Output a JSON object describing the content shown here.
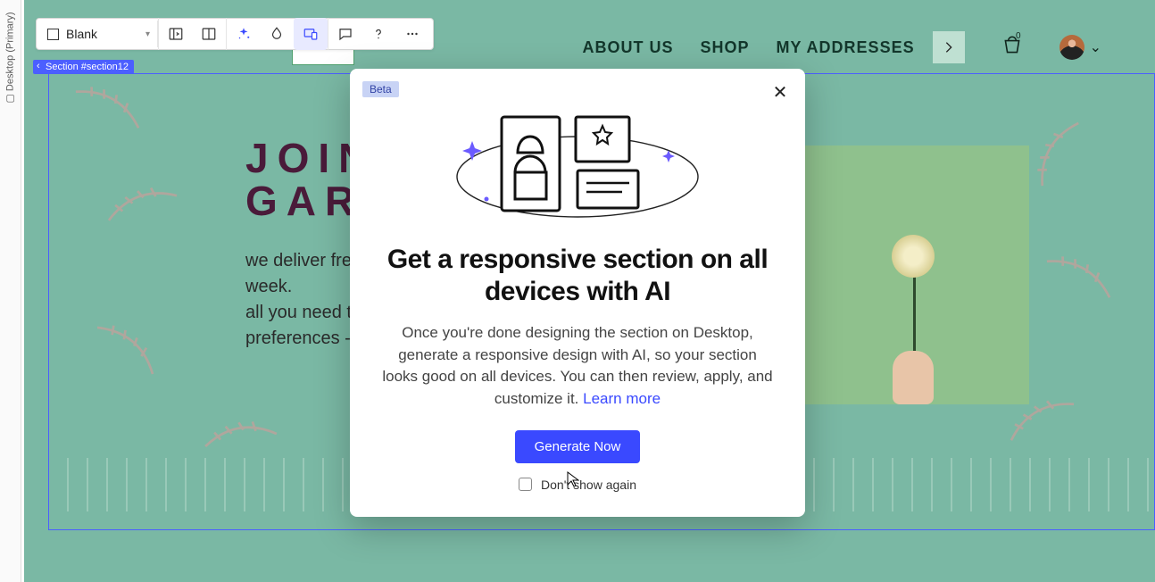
{
  "viewport_rail": {
    "label": "Desktop (Primary)"
  },
  "toolbar": {
    "dropdown_label": "Blank",
    "icons": [
      "panel-left",
      "panel-split",
      "ai-sparkle",
      "paint-drop",
      "responsive",
      "comment",
      "help",
      "more"
    ]
  },
  "site_nav": {
    "items": [
      "ABOUT US",
      "SHOP",
      "MY ADDRESSES"
    ],
    "cart_count": "0"
  },
  "section_tag": "Section #section12",
  "hero": {
    "title_line1": "JOIN",
    "title_line2": "GAR",
    "body_line1": "we deliver fresh",
    "body_line2": "week.",
    "body_line3": "all you need to d",
    "body_line4": "preferences - w"
  },
  "modal": {
    "badge": "Beta",
    "title": "Get a responsive section on all devices with AI",
    "body": "Once you're done designing the section on Desktop, generate a responsive design with AI, so your section looks good on all devices. You can then review, apply, and customize it. ",
    "learn_more": "Learn more",
    "cta": "Generate Now",
    "dont_show": "Don't show again"
  }
}
